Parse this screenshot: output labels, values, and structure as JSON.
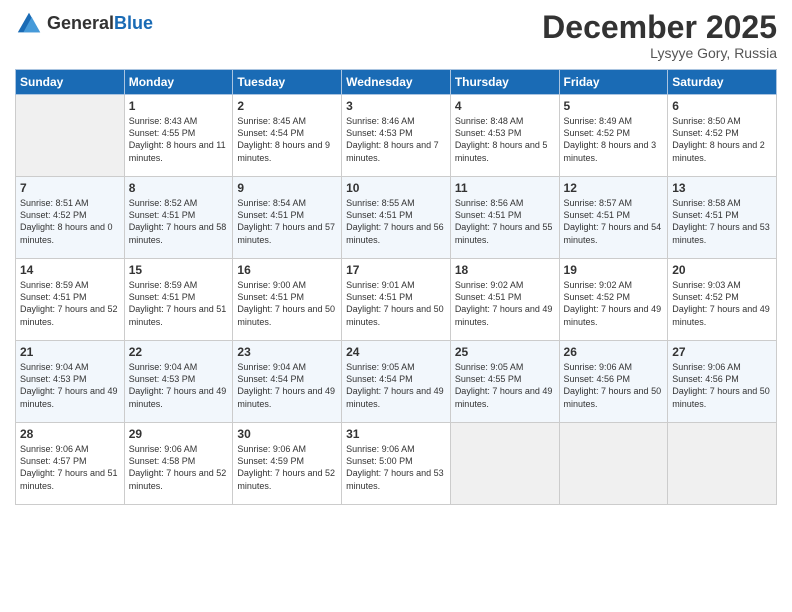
{
  "header": {
    "logo_line1": "General",
    "logo_line2": "Blue",
    "month": "December 2025",
    "location": "Lysyye Gory, Russia"
  },
  "columns": [
    "Sunday",
    "Monday",
    "Tuesday",
    "Wednesday",
    "Thursday",
    "Friday",
    "Saturday"
  ],
  "weeks": [
    [
      {
        "day": "",
        "sunrise": "",
        "sunset": "",
        "daylight": ""
      },
      {
        "day": "1",
        "sunrise": "Sunrise: 8:43 AM",
        "sunset": "Sunset: 4:55 PM",
        "daylight": "Daylight: 8 hours and 11 minutes."
      },
      {
        "day": "2",
        "sunrise": "Sunrise: 8:45 AM",
        "sunset": "Sunset: 4:54 PM",
        "daylight": "Daylight: 8 hours and 9 minutes."
      },
      {
        "day": "3",
        "sunrise": "Sunrise: 8:46 AM",
        "sunset": "Sunset: 4:53 PM",
        "daylight": "Daylight: 8 hours and 7 minutes."
      },
      {
        "day": "4",
        "sunrise": "Sunrise: 8:48 AM",
        "sunset": "Sunset: 4:53 PM",
        "daylight": "Daylight: 8 hours and 5 minutes."
      },
      {
        "day": "5",
        "sunrise": "Sunrise: 8:49 AM",
        "sunset": "Sunset: 4:52 PM",
        "daylight": "Daylight: 8 hours and 3 minutes."
      },
      {
        "day": "6",
        "sunrise": "Sunrise: 8:50 AM",
        "sunset": "Sunset: 4:52 PM",
        "daylight": "Daylight: 8 hours and 2 minutes."
      }
    ],
    [
      {
        "day": "7",
        "sunrise": "Sunrise: 8:51 AM",
        "sunset": "Sunset: 4:52 PM",
        "daylight": "Daylight: 8 hours and 0 minutes."
      },
      {
        "day": "8",
        "sunrise": "Sunrise: 8:52 AM",
        "sunset": "Sunset: 4:51 PM",
        "daylight": "Daylight: 7 hours and 58 minutes."
      },
      {
        "day": "9",
        "sunrise": "Sunrise: 8:54 AM",
        "sunset": "Sunset: 4:51 PM",
        "daylight": "Daylight: 7 hours and 57 minutes."
      },
      {
        "day": "10",
        "sunrise": "Sunrise: 8:55 AM",
        "sunset": "Sunset: 4:51 PM",
        "daylight": "Daylight: 7 hours and 56 minutes."
      },
      {
        "day": "11",
        "sunrise": "Sunrise: 8:56 AM",
        "sunset": "Sunset: 4:51 PM",
        "daylight": "Daylight: 7 hours and 55 minutes."
      },
      {
        "day": "12",
        "sunrise": "Sunrise: 8:57 AM",
        "sunset": "Sunset: 4:51 PM",
        "daylight": "Daylight: 7 hours and 54 minutes."
      },
      {
        "day": "13",
        "sunrise": "Sunrise: 8:58 AM",
        "sunset": "Sunset: 4:51 PM",
        "daylight": "Daylight: 7 hours and 53 minutes."
      }
    ],
    [
      {
        "day": "14",
        "sunrise": "Sunrise: 8:59 AM",
        "sunset": "Sunset: 4:51 PM",
        "daylight": "Daylight: 7 hours and 52 minutes."
      },
      {
        "day": "15",
        "sunrise": "Sunrise: 8:59 AM",
        "sunset": "Sunset: 4:51 PM",
        "daylight": "Daylight: 7 hours and 51 minutes."
      },
      {
        "day": "16",
        "sunrise": "Sunrise: 9:00 AM",
        "sunset": "Sunset: 4:51 PM",
        "daylight": "Daylight: 7 hours and 50 minutes."
      },
      {
        "day": "17",
        "sunrise": "Sunrise: 9:01 AM",
        "sunset": "Sunset: 4:51 PM",
        "daylight": "Daylight: 7 hours and 50 minutes."
      },
      {
        "day": "18",
        "sunrise": "Sunrise: 9:02 AM",
        "sunset": "Sunset: 4:51 PM",
        "daylight": "Daylight: 7 hours and 49 minutes."
      },
      {
        "day": "19",
        "sunrise": "Sunrise: 9:02 AM",
        "sunset": "Sunset: 4:52 PM",
        "daylight": "Daylight: 7 hours and 49 minutes."
      },
      {
        "day": "20",
        "sunrise": "Sunrise: 9:03 AM",
        "sunset": "Sunset: 4:52 PM",
        "daylight": "Daylight: 7 hours and 49 minutes."
      }
    ],
    [
      {
        "day": "21",
        "sunrise": "Sunrise: 9:04 AM",
        "sunset": "Sunset: 4:53 PM",
        "daylight": "Daylight: 7 hours and 49 minutes."
      },
      {
        "day": "22",
        "sunrise": "Sunrise: 9:04 AM",
        "sunset": "Sunset: 4:53 PM",
        "daylight": "Daylight: 7 hours and 49 minutes."
      },
      {
        "day": "23",
        "sunrise": "Sunrise: 9:04 AM",
        "sunset": "Sunset: 4:54 PM",
        "daylight": "Daylight: 7 hours and 49 minutes."
      },
      {
        "day": "24",
        "sunrise": "Sunrise: 9:05 AM",
        "sunset": "Sunset: 4:54 PM",
        "daylight": "Daylight: 7 hours and 49 minutes."
      },
      {
        "day": "25",
        "sunrise": "Sunrise: 9:05 AM",
        "sunset": "Sunset: 4:55 PM",
        "daylight": "Daylight: 7 hours and 49 minutes."
      },
      {
        "day": "26",
        "sunrise": "Sunrise: 9:06 AM",
        "sunset": "Sunset: 4:56 PM",
        "daylight": "Daylight: 7 hours and 50 minutes."
      },
      {
        "day": "27",
        "sunrise": "Sunrise: 9:06 AM",
        "sunset": "Sunset: 4:56 PM",
        "daylight": "Daylight: 7 hours and 50 minutes."
      }
    ],
    [
      {
        "day": "28",
        "sunrise": "Sunrise: 9:06 AM",
        "sunset": "Sunset: 4:57 PM",
        "daylight": "Daylight: 7 hours and 51 minutes."
      },
      {
        "day": "29",
        "sunrise": "Sunrise: 9:06 AM",
        "sunset": "Sunset: 4:58 PM",
        "daylight": "Daylight: 7 hours and 52 minutes."
      },
      {
        "day": "30",
        "sunrise": "Sunrise: 9:06 AM",
        "sunset": "Sunset: 4:59 PM",
        "daylight": "Daylight: 7 hours and 52 minutes."
      },
      {
        "day": "31",
        "sunrise": "Sunrise: 9:06 AM",
        "sunset": "Sunset: 5:00 PM",
        "daylight": "Daylight: 7 hours and 53 minutes."
      },
      {
        "day": "",
        "sunrise": "",
        "sunset": "",
        "daylight": ""
      },
      {
        "day": "",
        "sunrise": "",
        "sunset": "",
        "daylight": ""
      },
      {
        "day": "",
        "sunrise": "",
        "sunset": "",
        "daylight": ""
      }
    ]
  ]
}
